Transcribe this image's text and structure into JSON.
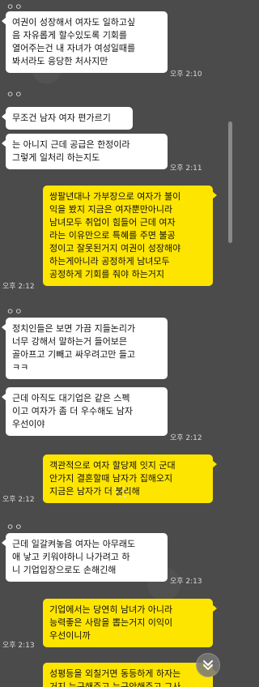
{
  "chat": {
    "messages": [
      {
        "id": "m1",
        "side": "in",
        "text": "여권이 성장해서 여자도 일하고싶\n음 자유롭게 할수있도록 기회를\n열어주는건 내 자녀가 여성일때를\n봐서라도 응당한 처사지만",
        "time": "오후 2:10"
      },
      {
        "id": "m2",
        "side": "in",
        "text": "무조건 남자 여자 편가르기",
        "time": ""
      },
      {
        "id": "m3",
        "side": "in",
        "text": "는 아니지 근데 공급은 한정이라\n그렇게 일처리 하는지도",
        "time": "오후 2:11"
      },
      {
        "id": "m4",
        "side": "out",
        "text": "쌍팔년대나 가부장으로 여자가 불이\n익을 봤지 지금은 여자뿐만아니라\n남녀모두 취업이 힘들어 근데 여자\n라는 이유만으로 특혜를 주면 불공\n정이고 잘못된거지 여권이 성장해야\n하는게아니라 공정하게 남녀모두\n공정하게 기회를 줘야 하는거지",
        "time": "오후 2:12"
      },
      {
        "id": "m5",
        "side": "in",
        "text": "정치인들은 보면 가끔 지들논리가\n너무 강해서 말하는거 들어보믄\n골아프고 기빼고 싸우려고만 들고\nㅋㅋ",
        "time": ""
      },
      {
        "id": "m6",
        "side": "in",
        "text": "근데 아직도 대기업은 같은 스펙\n이고 여자가 좀 더 우수해도 남자\n우선이야",
        "time": "오후 2:12"
      },
      {
        "id": "m7",
        "side": "out",
        "text": "객관적으로 여자 할당제 잇지 군대\n안가지 결혼할때 남자가 집해오지\n지금은 남자가 더 불리해",
        "time": "오후 2:12"
      },
      {
        "id": "m8",
        "side": "in",
        "text": "근데 일갈켜놓음 여자는 아무래도\n애 낳고 키워야하니 나가려고 하\n니 기업입장으로도 손해긴해",
        "time": "오후 2:13"
      },
      {
        "id": "m9",
        "side": "out",
        "text": "기업에서는 당연히 남녀가 아니라\n능력좋은 사람을 뽑는거지 이익이\n우선이니까",
        "time": "오후 2:13"
      },
      {
        "id": "m10",
        "side": "out",
        "text": "성평등을 외칠거면 동등하게 하자는\n거지 누구해주고 누구안해주고 그사",
        "time": ""
      }
    ],
    "sender_marks": [
      "ㅇㅇ",
      "ㅇㅇ",
      "ㅇㅇ",
      "ㅇㅇ"
    ]
  },
  "controls": {
    "scroll_down_icon": "chevron-double-down-icon"
  },
  "colors": {
    "background": "#4b4b4b",
    "incoming_bubble": "#ffffff",
    "outgoing_bubble": "#fee500"
  }
}
